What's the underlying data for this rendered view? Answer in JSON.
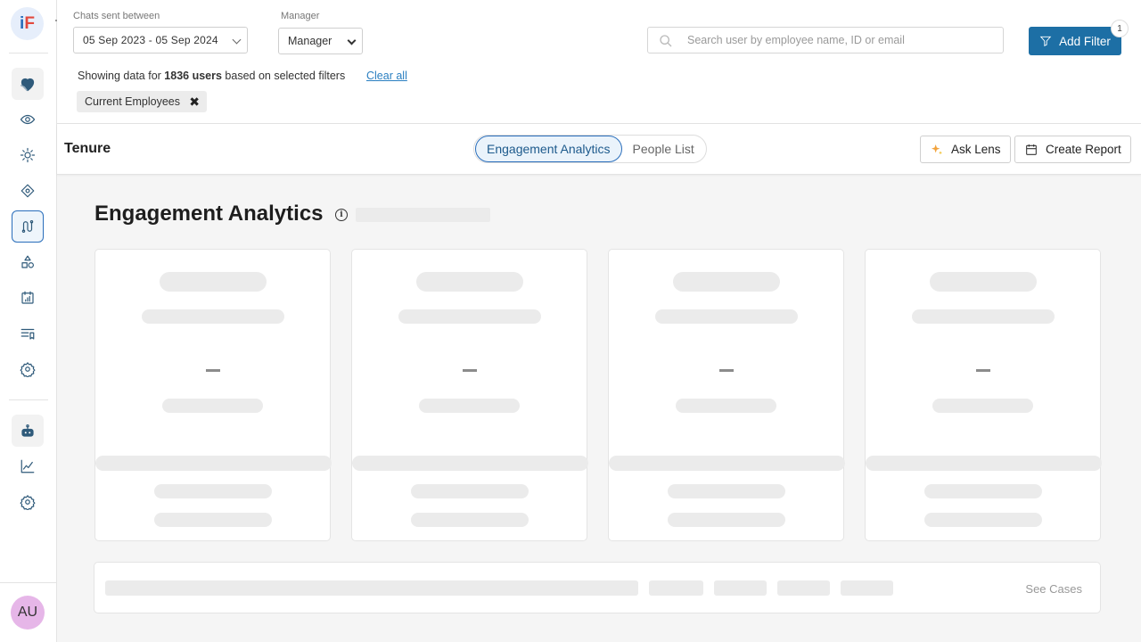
{
  "app": {
    "logo_i": "i",
    "logo_f": "F"
  },
  "sidebar": {
    "items": [
      {
        "name": "heart-hands",
        "icon": "heart-icon"
      },
      {
        "name": "eye",
        "icon": "eye-icon"
      },
      {
        "name": "sun",
        "icon": "sun-icon"
      },
      {
        "name": "diamond",
        "icon": "diamond-icon"
      },
      {
        "name": "journey",
        "icon": "route-icon",
        "active": true
      },
      {
        "name": "org",
        "icon": "shapes-icon"
      },
      {
        "name": "calendar",
        "icon": "calendar-icon"
      },
      {
        "name": "list",
        "icon": "list-icon"
      },
      {
        "name": "settings",
        "icon": "gear-icon"
      },
      {
        "name": "bot",
        "icon": "robot-icon"
      },
      {
        "name": "analytics",
        "icon": "chart-line-icon"
      },
      {
        "name": "settings2",
        "icon": "gear-icon"
      }
    ],
    "avatar_initials": "AU"
  },
  "header": {
    "date_label": "Chats sent between",
    "date_value": "05 Sep 2023 - 05 Sep 2024",
    "manager_label": "Manager",
    "manager_value": "Manager",
    "search_placeholder": "Search user by employee name, ID or email",
    "add_filter_label": "Add Filter",
    "filter_badge": "1",
    "showing_prefix": "Showing data for ",
    "showing_count": "1836 users",
    "showing_suffix": " based on selected filters",
    "clear_all": "Clear all",
    "chip_label": "Current Employees",
    "chip_close": "✖"
  },
  "subheader": {
    "title": "Tenure",
    "tabs": [
      {
        "label": "Engagement Analytics",
        "active": true
      },
      {
        "label": "People List",
        "active": false
      }
    ],
    "ask_lens_label": "Ask Lens",
    "create_report_label": "Create Report"
  },
  "main": {
    "title": "Engagement Analytics",
    "info_glyph": "i",
    "cards": [
      {
        "value": "–"
      },
      {
        "value": "–"
      },
      {
        "value": "–"
      },
      {
        "value": "–"
      }
    ],
    "see_cases": "See Cases"
  },
  "colors": {
    "primary": "#1d6fa5",
    "active_nav": "#2a6ebb",
    "link": "#2a7fc1",
    "skeleton": "#ebebeb"
  }
}
